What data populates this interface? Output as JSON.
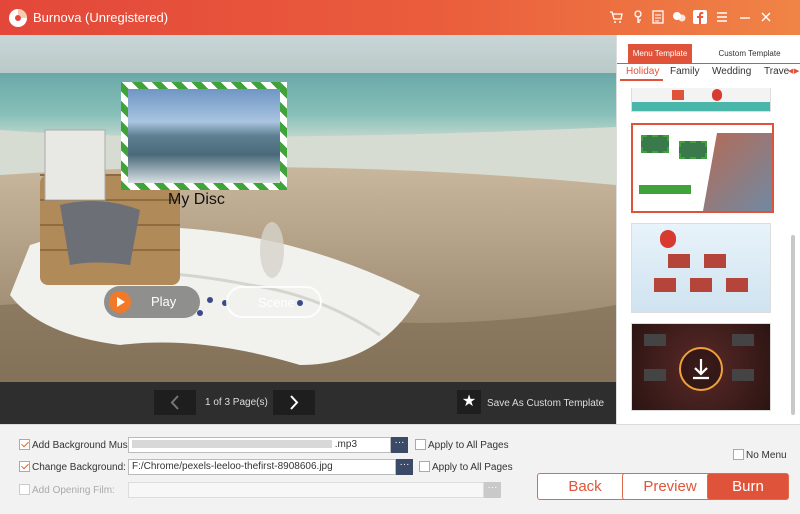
{
  "app": {
    "title": "Burnova (Unregistered)"
  },
  "titlebar": {
    "icons": [
      "cart-icon",
      "key-icon",
      "register-icon",
      "feedback-icon",
      "facebook-icon",
      "menu-icon",
      "minimize-icon",
      "close-icon"
    ]
  },
  "preview": {
    "disc_title": "My Disc",
    "play_label": "Play",
    "scene_label": "Scene"
  },
  "navigation": {
    "page_indicator": "1 of 3 Page(s)",
    "save_template_label": "Save As Custom Template"
  },
  "template_panel": {
    "tabs": [
      "Menu Template",
      "Custom Template"
    ],
    "active_tab": "Menu Template",
    "categories": [
      "Holiday",
      "Family",
      "Wedding",
      "Travel"
    ],
    "category_display": [
      "Holiday",
      "Family",
      "Wedding",
      "Trave"
    ],
    "active_category": "Holiday"
  },
  "settings": {
    "background_music": {
      "label": "Add Background Music:",
      "value": ".mp3",
      "checked": true,
      "apply_all_label": "Apply to All Pages"
    },
    "background": {
      "label": "Change Background:",
      "value": "F:/Chrome/pexels-leeloo-thefirst-8908606.jpg",
      "checked": true,
      "apply_all_label": "Apply to All Pages"
    },
    "opening_film": {
      "label": "Add Opening Film:",
      "value": "",
      "checked": false
    },
    "no_menu_label": "No Menu",
    "browse_label": "···"
  },
  "buttons": {
    "back": "Back",
    "preview": "Preview",
    "burn": "Burn"
  },
  "colors": {
    "accent": "#e0533b",
    "titlebar_start": "#e3473a",
    "titlebar_end": "#f08446",
    "panel_dark": "#2e2e2e"
  }
}
